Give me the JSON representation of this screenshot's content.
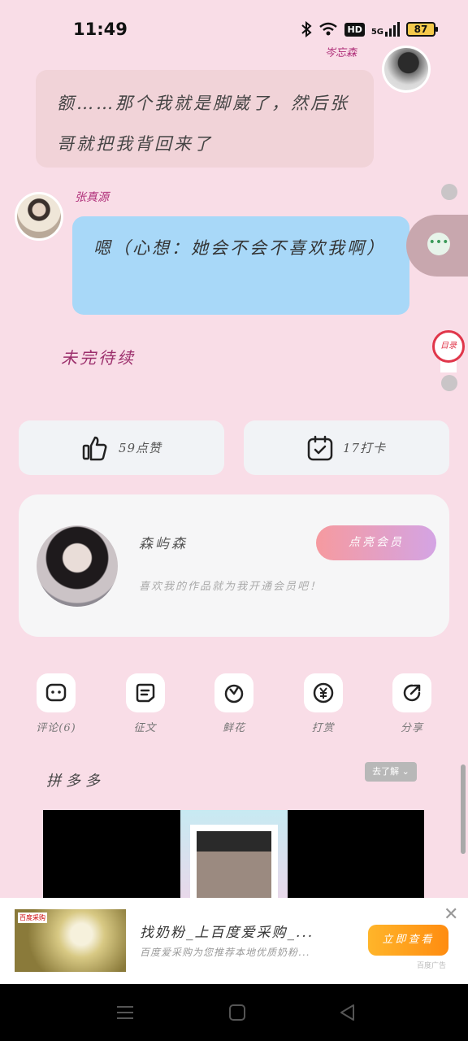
{
  "status_bar": {
    "time": "11:49",
    "network": "5G",
    "hd": "HD",
    "battery": "87"
  },
  "chat": {
    "top_name": "岑忘森",
    "top_message": "额……那个我就是脚崴了，然后张哥就把我背回来了",
    "zhang_name": "张真源",
    "zhang_message": "嗯（心想：她会不会不喜欢我啊）",
    "to_be_continued": "未完待续",
    "pin_label": "目录"
  },
  "actions": {
    "like_label": "59点赞",
    "checkin_label": "17打卡"
  },
  "author": {
    "name": "森屿森",
    "description": "喜欢我的作品就为我开通会员吧！",
    "member_button": "点亮会员"
  },
  "toolbar": [
    {
      "icon": "comment-icon",
      "label": "评论(6)"
    },
    {
      "icon": "essay-icon",
      "label": "征文"
    },
    {
      "icon": "flower-icon",
      "label": "鲜花"
    },
    {
      "icon": "reward-icon",
      "label": "打赏"
    },
    {
      "icon": "share-icon",
      "label": "分享"
    }
  ],
  "pdd": {
    "title": "拼多多",
    "chip": "去了解"
  },
  "ad": {
    "image_tag": "百度采购",
    "title": "找奶粉_上百度爱采购_...",
    "description": "百度爱采购为您推荐本地优质奶粉...",
    "button": "立即查看",
    "source": "百度广告"
  },
  "colors": {
    "accent": "#b0307a",
    "bubble_blue": "#a8d8f8",
    "bubble_pink": "#f1d3d8"
  }
}
